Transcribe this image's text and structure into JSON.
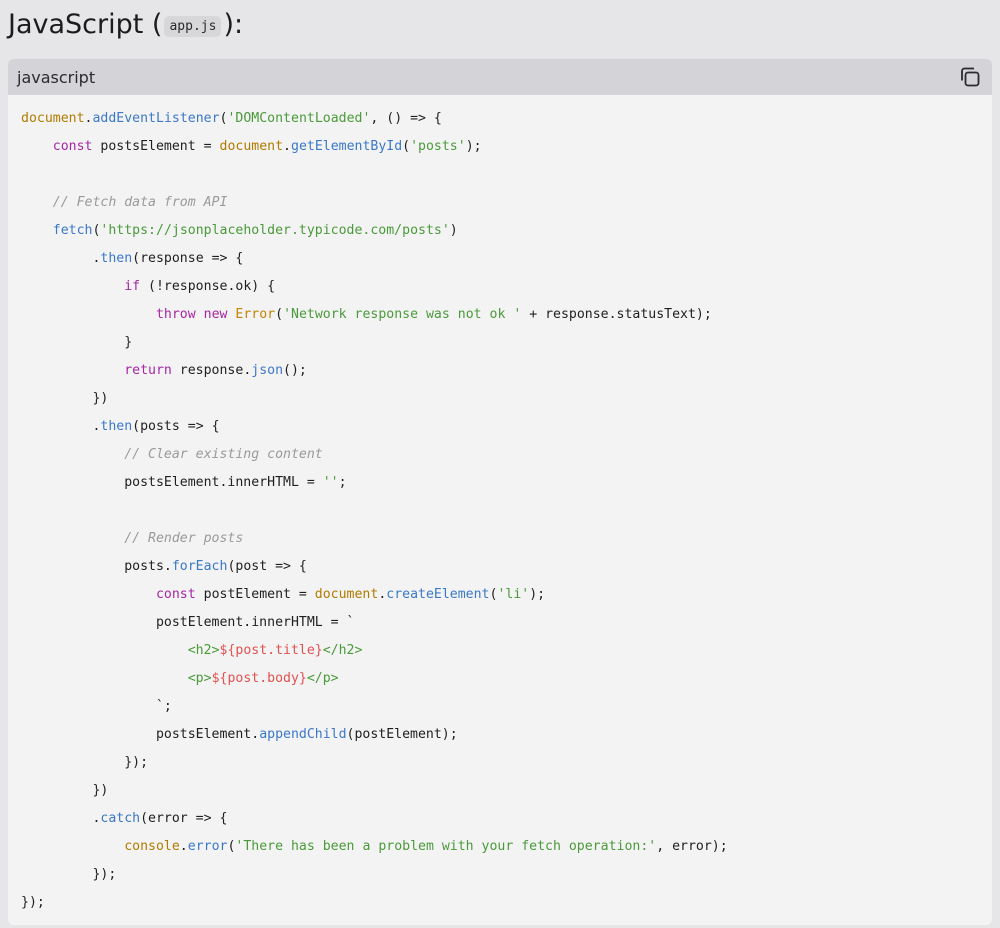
{
  "heading": {
    "prefix": "JavaScript (",
    "filename": "app.js",
    "suffix": "):"
  },
  "code_block": {
    "language": "javascript",
    "copy_icon": "copy-icon",
    "colors": {
      "plain": "#1f1f1f",
      "keyword": "#a626a4",
      "builtin": "#b07b00",
      "method": "#3b78c9",
      "string": "#4a9a3a",
      "comment": "#9a9a9a",
      "class": "#c18401",
      "interp": "#e05252"
    },
    "lines": [
      [
        [
          "builtin",
          "document"
        ],
        [
          "plain",
          "."
        ],
        [
          "method",
          "addEventListener"
        ],
        [
          "plain",
          "("
        ],
        [
          "string",
          "'DOMContentLoaded'"
        ],
        [
          "plain",
          ", () => {"
        ]
      ],
      [
        [
          "plain",
          "    "
        ],
        [
          "keyword",
          "const"
        ],
        [
          "plain",
          " postsElement = "
        ],
        [
          "builtin",
          "document"
        ],
        [
          "plain",
          "."
        ],
        [
          "method",
          "getElementById"
        ],
        [
          "plain",
          "("
        ],
        [
          "string",
          "'posts'"
        ],
        [
          "plain",
          ");"
        ]
      ],
      [],
      [
        [
          "plain",
          "    "
        ],
        [
          "comment",
          "// Fetch data from API"
        ]
      ],
      [
        [
          "plain",
          "    "
        ],
        [
          "method",
          "fetch"
        ],
        [
          "plain",
          "("
        ],
        [
          "string",
          "'https://jsonplaceholder.typicode.com/posts'"
        ],
        [
          "plain",
          ")"
        ]
      ],
      [
        [
          "plain",
          "         ."
        ],
        [
          "method",
          "then"
        ],
        [
          "plain",
          "(response => {"
        ]
      ],
      [
        [
          "plain",
          "             "
        ],
        [
          "keyword",
          "if"
        ],
        [
          "plain",
          " (!response.ok) {"
        ]
      ],
      [
        [
          "plain",
          "                 "
        ],
        [
          "keyword",
          "throw"
        ],
        [
          "plain",
          " "
        ],
        [
          "keyword",
          "new"
        ],
        [
          "plain",
          " "
        ],
        [
          "class",
          "Error"
        ],
        [
          "plain",
          "("
        ],
        [
          "string",
          "'Network response was not ok '"
        ],
        [
          "plain",
          " + response.statusText);"
        ]
      ],
      [
        [
          "plain",
          "             }"
        ]
      ],
      [
        [
          "plain",
          "             "
        ],
        [
          "keyword",
          "return"
        ],
        [
          "plain",
          " response."
        ],
        [
          "method",
          "json"
        ],
        [
          "plain",
          "();"
        ]
      ],
      [
        [
          "plain",
          "         })"
        ]
      ],
      [
        [
          "plain",
          "         ."
        ],
        [
          "method",
          "then"
        ],
        [
          "plain",
          "(posts => {"
        ]
      ],
      [
        [
          "plain",
          "             "
        ],
        [
          "comment",
          "// Clear existing content"
        ]
      ],
      [
        [
          "plain",
          "             postsElement.innerHTML = "
        ],
        [
          "string",
          "''"
        ],
        [
          "plain",
          ";"
        ]
      ],
      [],
      [
        [
          "plain",
          "             "
        ],
        [
          "comment",
          "// Render posts"
        ]
      ],
      [
        [
          "plain",
          "             posts."
        ],
        [
          "method",
          "forEach"
        ],
        [
          "plain",
          "(post => {"
        ]
      ],
      [
        [
          "plain",
          "                 "
        ],
        [
          "keyword",
          "const"
        ],
        [
          "plain",
          " postElement = "
        ],
        [
          "builtin",
          "document"
        ],
        [
          "plain",
          "."
        ],
        [
          "method",
          "createElement"
        ],
        [
          "plain",
          "("
        ],
        [
          "string",
          "'li'"
        ],
        [
          "plain",
          ");"
        ]
      ],
      [
        [
          "plain",
          "                 postElement.innerHTML = `"
        ]
      ],
      [
        [
          "plain",
          "                     "
        ],
        [
          "string",
          "<h2>"
        ],
        [
          "interp",
          "${post.title}"
        ],
        [
          "string",
          "</h2>"
        ]
      ],
      [
        [
          "plain",
          "                     "
        ],
        [
          "string",
          "<p>"
        ],
        [
          "interp",
          "${post.body}"
        ],
        [
          "string",
          "</p>"
        ]
      ],
      [
        [
          "plain",
          "                 `;"
        ]
      ],
      [
        [
          "plain",
          "                 postsElement."
        ],
        [
          "method",
          "appendChild"
        ],
        [
          "plain",
          "(postElement);"
        ]
      ],
      [
        [
          "plain",
          "             });"
        ]
      ],
      [
        [
          "plain",
          "         })"
        ]
      ],
      [
        [
          "plain",
          "         ."
        ],
        [
          "method",
          "catch"
        ],
        [
          "plain",
          "(error => {"
        ]
      ],
      [
        [
          "plain",
          "             "
        ],
        [
          "builtin",
          "console"
        ],
        [
          "plain",
          "."
        ],
        [
          "method",
          "error"
        ],
        [
          "plain",
          "("
        ],
        [
          "string",
          "'There has been a problem with your fetch operation:'"
        ],
        [
          "plain",
          ", error);"
        ]
      ],
      [
        [
          "plain",
          "         });"
        ]
      ],
      [
        [
          "plain",
          "});"
        ]
      ]
    ]
  }
}
